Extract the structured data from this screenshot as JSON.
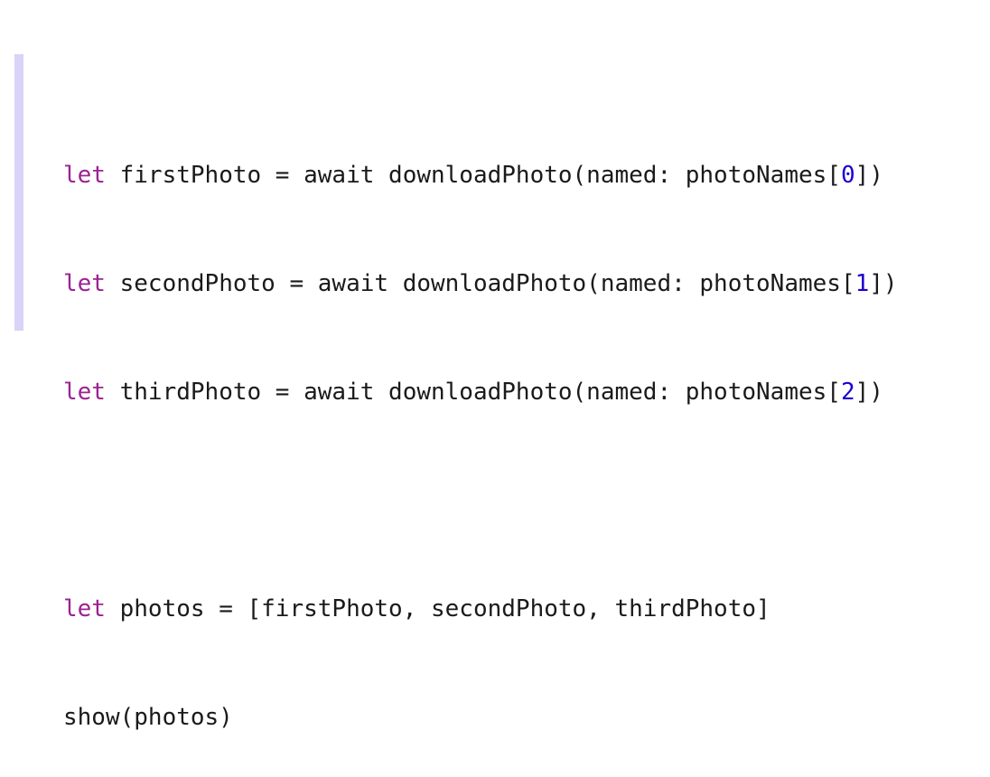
{
  "code": {
    "lines": [
      {
        "keyword": "let",
        "before_num": " firstPhoto = await downloadPhoto(named: photoNames[",
        "number": "0",
        "after_num": "])"
      },
      {
        "keyword": "let",
        "before_num": " secondPhoto = await downloadPhoto(named: photoNames[",
        "number": "1",
        "after_num": "])"
      },
      {
        "keyword": "let",
        "before_num": " thirdPhoto = await downloadPhoto(named: photoNames[",
        "number": "2",
        "after_num": "])"
      }
    ],
    "photos_line": {
      "keyword": "let",
      "rest": " photos = [firstPhoto, secondPhoto, thirdPhoto]"
    },
    "show_line": "show(photos)"
  },
  "colors": {
    "keyword": "#9b2393",
    "number": "#1c00cf",
    "text": "#1a1a1a",
    "accent_bar": "#d9d3f7"
  }
}
